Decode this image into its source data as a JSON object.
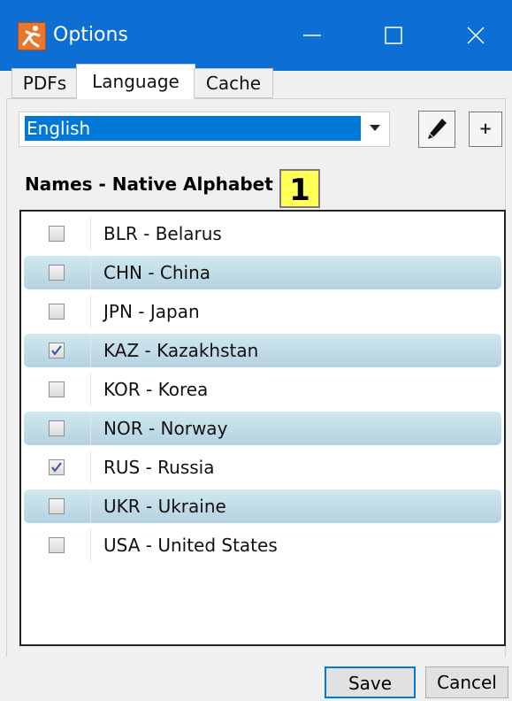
{
  "window": {
    "title": "Options",
    "accent_color": "#0d6ed4"
  },
  "tabs": [
    {
      "label": "PDFs",
      "active": false
    },
    {
      "label": "Language",
      "active": true
    },
    {
      "label": "Cache",
      "active": false
    }
  ],
  "language": {
    "selected": "English",
    "edit_icon": "pencil-icon",
    "add_label": "+"
  },
  "section": {
    "label": "Names - Native Alphabet",
    "badge": "1"
  },
  "countries": [
    {
      "label": "BLR - Belarus",
      "checked": false
    },
    {
      "label": "CHN - China",
      "checked": false
    },
    {
      "label": "JPN - Japan",
      "checked": false
    },
    {
      "label": "KAZ - Kazakhstan",
      "checked": true
    },
    {
      "label": "KOR - Korea",
      "checked": false
    },
    {
      "label": "NOR - Norway",
      "checked": false
    },
    {
      "label": "RUS - Russia",
      "checked": true
    },
    {
      "label": "UKR - Ukraine",
      "checked": false
    },
    {
      "label": "USA - United States",
      "checked": false
    }
  ],
  "footer": {
    "save_label": "Save",
    "cancel_label": "Cancel"
  }
}
